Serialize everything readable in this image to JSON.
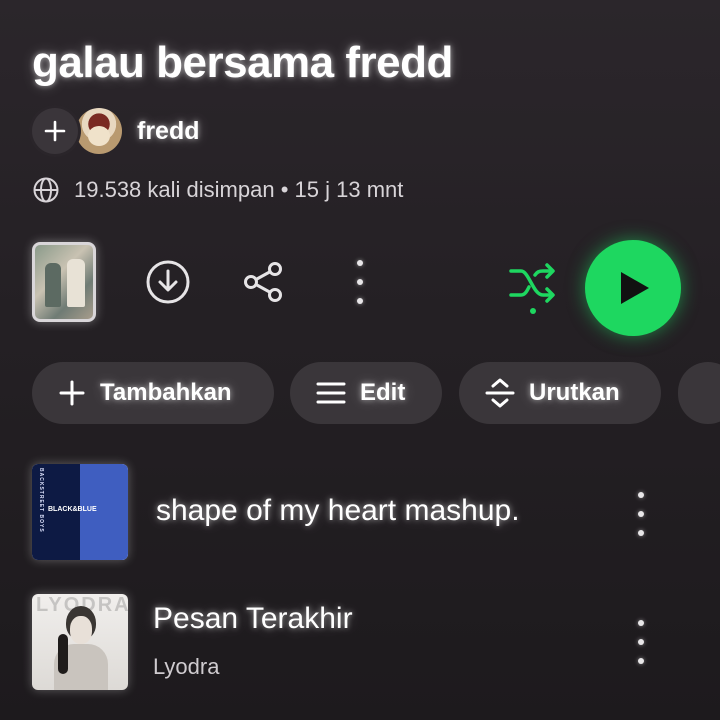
{
  "playlist": {
    "title": "galau bersama fredd",
    "owner": "fredd",
    "saves_text": "19.538 kali disimpan",
    "separator": "•",
    "duration_text": "15 j 13 mnt"
  },
  "icons": {
    "add_collaborator": "plus-icon",
    "meta": "globe-icon",
    "download": "download-icon",
    "share": "share-icon",
    "more": "more-vertical-icon",
    "shuffle": "shuffle-icon",
    "play": "play-icon"
  },
  "colors": {
    "accent": "#1ed760",
    "background": "#242024",
    "chip": "#3a363a"
  },
  "actions": {
    "chips": [
      {
        "label": "Tambahkan",
        "icon": "plus-icon"
      },
      {
        "label": "Edit",
        "icon": "list-icon"
      },
      {
        "label": "Urutkan",
        "icon": "sort-icon"
      }
    ]
  },
  "tracks": [
    {
      "title": "shape of my heart mashup.",
      "artist": ""
    },
    {
      "title": "Pesan Terakhir",
      "artist": "Lyodra"
    }
  ],
  "album_art": {
    "track_1_text": "BACKSTREET BOYS",
    "track_1_logo": "BLACK&BLUE",
    "track_2_watermark": "LYODRA"
  }
}
